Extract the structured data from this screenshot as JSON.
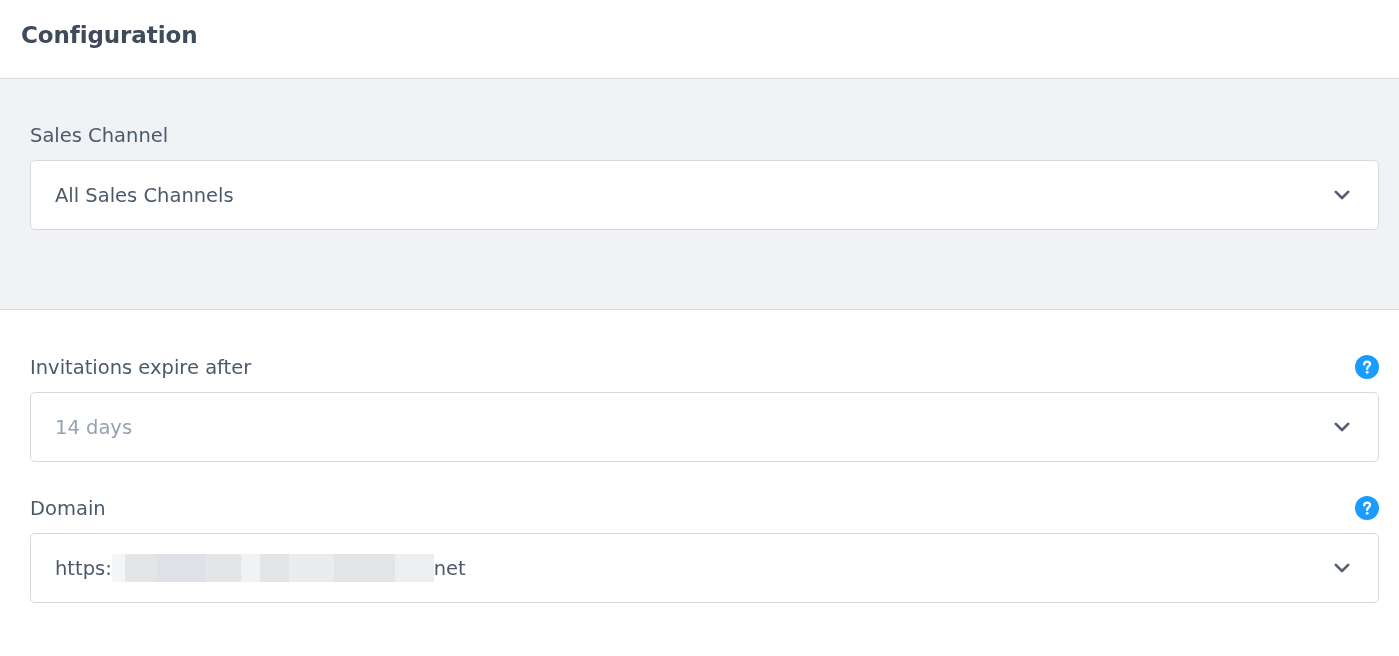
{
  "header": {
    "title": "Configuration"
  },
  "sections": [
    {
      "kind": "shaded",
      "fields": [
        {
          "label": "Sales Channel",
          "value": "All Sales Channels",
          "help": false
        }
      ]
    },
    {
      "kind": "plain",
      "fields": [
        {
          "label": "Invitations expire after",
          "placeholder": "14 days",
          "help": true
        },
        {
          "label": "Domain",
          "value_start": "https:",
          "value_end": "net",
          "redacted": true,
          "help": true
        }
      ]
    }
  ]
}
